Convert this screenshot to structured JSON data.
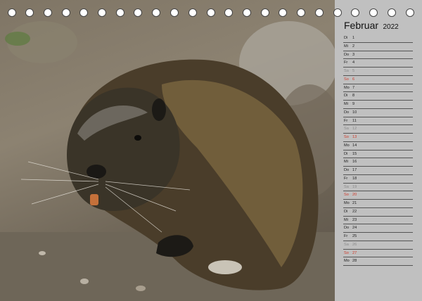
{
  "calendar": {
    "month": "Februar",
    "year": "2022",
    "days": [
      {
        "wd": "Di",
        "d": "1",
        "type": "weekday"
      },
      {
        "wd": "Mi",
        "d": "2",
        "type": "weekday"
      },
      {
        "wd": "Do",
        "d": "3",
        "type": "weekday"
      },
      {
        "wd": "Fr",
        "d": "4",
        "type": "weekday"
      },
      {
        "wd": "Sa",
        "d": "5",
        "type": "sat"
      },
      {
        "wd": "So",
        "d": "6",
        "type": "sun"
      },
      {
        "wd": "Mo",
        "d": "7",
        "type": "weekday"
      },
      {
        "wd": "Di",
        "d": "8",
        "type": "weekday"
      },
      {
        "wd": "Mi",
        "d": "9",
        "type": "weekday"
      },
      {
        "wd": "Do",
        "d": "10",
        "type": "weekday"
      },
      {
        "wd": "Fr",
        "d": "11",
        "type": "weekday"
      },
      {
        "wd": "Sa",
        "d": "12",
        "type": "sat"
      },
      {
        "wd": "So",
        "d": "13",
        "type": "sun"
      },
      {
        "wd": "Mo",
        "d": "14",
        "type": "weekday"
      },
      {
        "wd": "Di",
        "d": "15",
        "type": "weekday"
      },
      {
        "wd": "Mi",
        "d": "16",
        "type": "weekday"
      },
      {
        "wd": "Do",
        "d": "17",
        "type": "weekday"
      },
      {
        "wd": "Fr",
        "d": "18",
        "type": "weekday"
      },
      {
        "wd": "Sa",
        "d": "19",
        "type": "sat"
      },
      {
        "wd": "So",
        "d": "20",
        "type": "sun"
      },
      {
        "wd": "Mo",
        "d": "21",
        "type": "weekday"
      },
      {
        "wd": "Di",
        "d": "22",
        "type": "weekday"
      },
      {
        "wd": "Mi",
        "d": "23",
        "type": "weekday"
      },
      {
        "wd": "Do",
        "d": "24",
        "type": "weekday"
      },
      {
        "wd": "Fr",
        "d": "25",
        "type": "weekday"
      },
      {
        "wd": "Sa",
        "d": "26",
        "type": "sat"
      },
      {
        "wd": "So",
        "d": "27",
        "type": "sun"
      },
      {
        "wd": "Mo",
        "d": "28",
        "type": "weekday"
      }
    ]
  },
  "colors": {
    "sunday": "#d23a2a",
    "saturday": "#8a8a8a",
    "panel": "#c0c0c0"
  },
  "icons": {
    "binding": "binding-hole-icon"
  }
}
